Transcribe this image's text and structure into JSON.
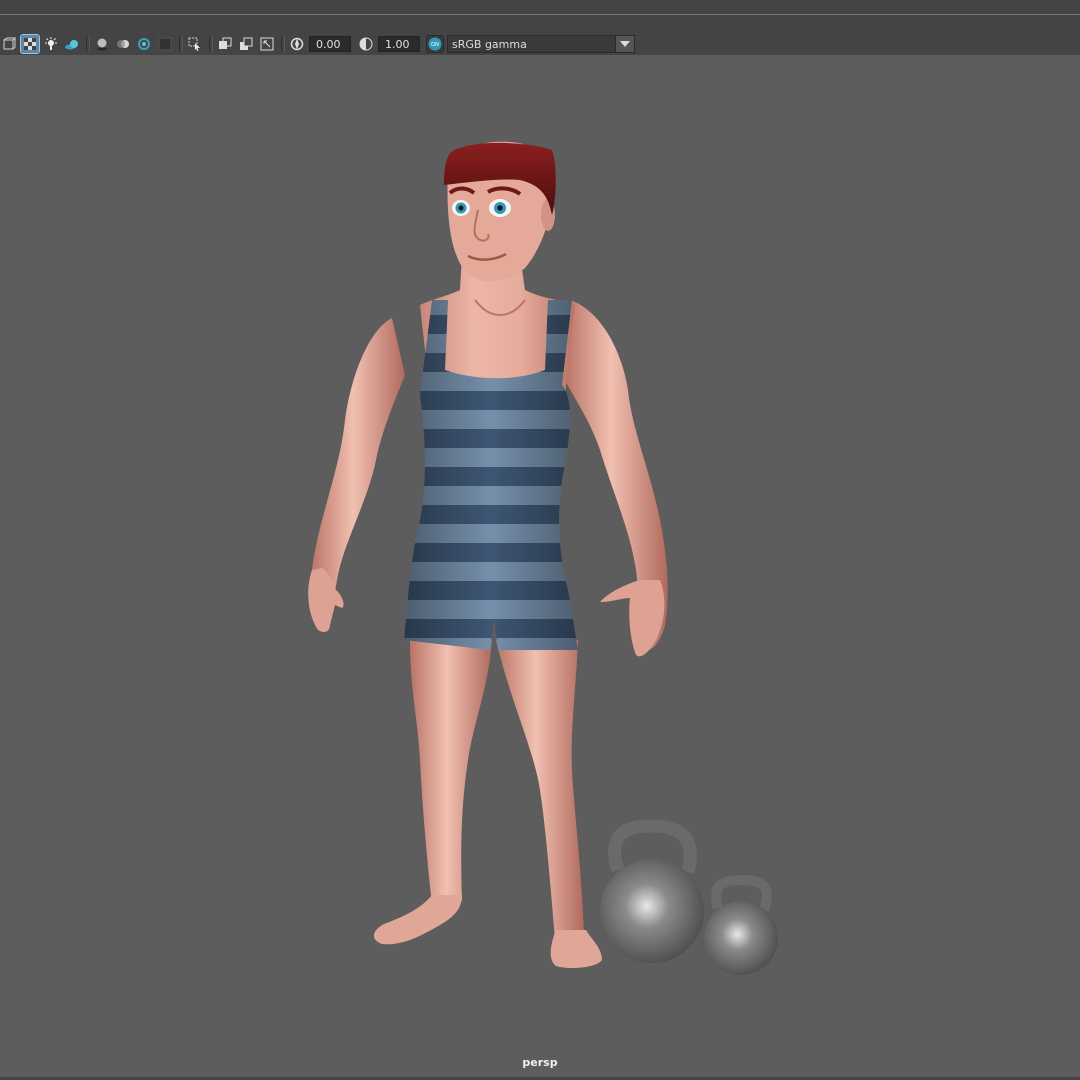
{
  "toolbar": {
    "exposure_value": "0.00",
    "gamma_value": "1.00",
    "colorspace_label": "sRGB gamma",
    "colorspace_toggle_label": "ON"
  },
  "viewport": {
    "camera_label": "persp"
  },
  "colors": {
    "background": "#5d5d5d",
    "toolbar": "#444444",
    "accent": "#3aa0c0",
    "skin": "#e0a595",
    "swimsuit_dark": "#3f5875",
    "swimsuit_light": "#7691ad",
    "hair": "#6e1414",
    "kettlebell": "#6c6c6c"
  }
}
